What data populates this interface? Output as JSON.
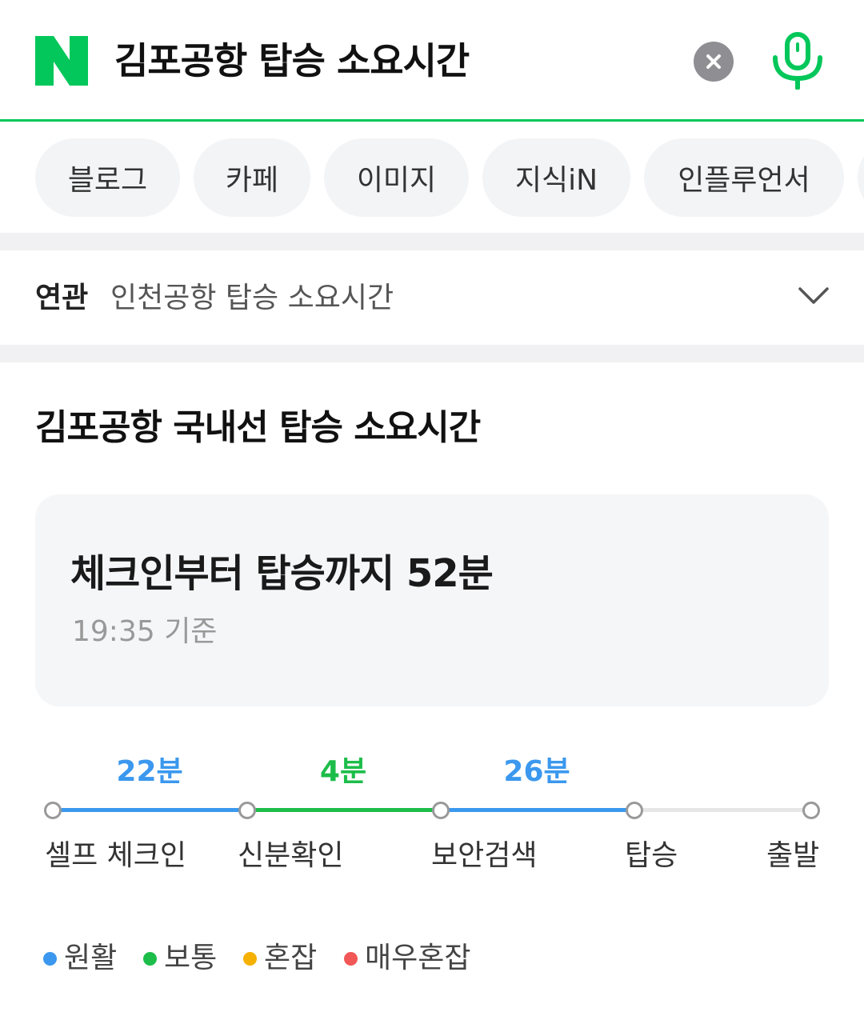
{
  "search": {
    "query": "김포공항 탑승 소요시간",
    "logo_icon": "naver-n-logo",
    "clear_icon": "close-icon",
    "mic_icon": "microphone-icon",
    "brand_color": "#03c75a"
  },
  "tabs": [
    {
      "label": "블로그"
    },
    {
      "label": "카페"
    },
    {
      "label": "이미지"
    },
    {
      "label": "지식iN"
    },
    {
      "label": "인플루언서"
    }
  ],
  "related": {
    "label": "연관",
    "text": "인천공항 탑승 소요시간",
    "chevron_icon": "chevron-down-icon"
  },
  "section": {
    "title": "김포공항 국내선 탑승 소요시간"
  },
  "summary": {
    "main": "체크인부터 탑승까지 52분",
    "timestamp": "19:35 기준"
  },
  "timeline": {
    "durations": [
      {
        "text": "22분",
        "status": "원활",
        "color": "#3b98ee"
      },
      {
        "text": "4분",
        "status": "보통",
        "color": "#1dbd4a"
      },
      {
        "text": "26분",
        "status": "원활",
        "color": "#3b98ee"
      }
    ],
    "steps": [
      "셀프 체크인",
      "신분확인",
      "보안검색",
      "탑승",
      "출발"
    ],
    "inactive_color": "#e6e6e6"
  },
  "legend": [
    {
      "label": "원활",
      "color": "#3b98ee"
    },
    {
      "label": "보통",
      "color": "#1dbd4a"
    },
    {
      "label": "혼잡",
      "color": "#f5b000"
    },
    {
      "label": "매우혼잡",
      "color": "#f25757"
    }
  ]
}
